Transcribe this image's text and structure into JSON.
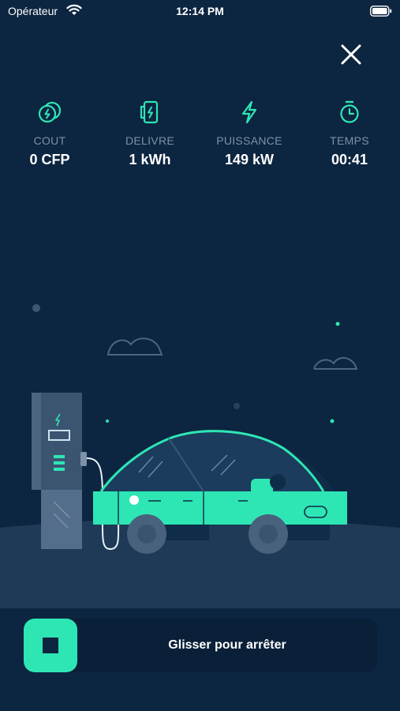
{
  "status_bar": {
    "carrier": "Opérateur",
    "time": "12:14 PM"
  },
  "stats": [
    {
      "icon": "coins-icon",
      "label": "COUT",
      "value": "0 CFP"
    },
    {
      "icon": "energy-delivered-icon",
      "label": "DELIVRE",
      "value": "1 kWh"
    },
    {
      "icon": "lightning-icon",
      "label": "PUISSANCE",
      "value": "149 kW"
    },
    {
      "icon": "stopwatch-icon",
      "label": "TEMPS",
      "value": "00:41"
    }
  ],
  "slider": {
    "label": "Glisser pour arrêter",
    "icon": "stop-icon"
  },
  "colors": {
    "background": "#0c2540",
    "accent": "#2ee6b4",
    "label": "#7d93a8",
    "ground": "#1e3a56"
  }
}
